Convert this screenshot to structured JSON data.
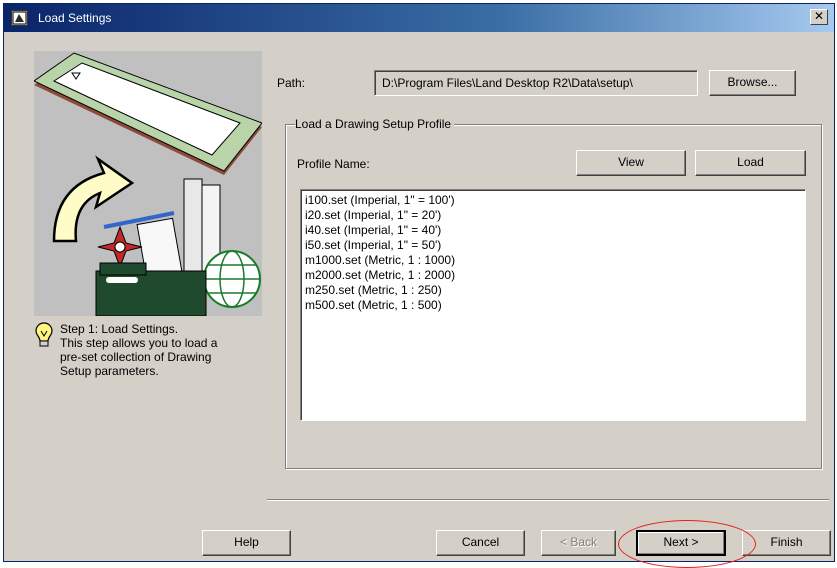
{
  "window": {
    "title": "Load Settings",
    "close_label": "✕"
  },
  "sidebar": {
    "step_lines": [
      "Step 1:  Load Settings.",
      "This step allows you to load a",
      "pre-set collection of Drawing",
      "Setup parameters."
    ]
  },
  "path": {
    "label": "Path:",
    "value": "D:\\Program Files\\Land Desktop R2\\Data\\setup\\",
    "browse_label": "Browse..."
  },
  "profile_group": {
    "title": "Load a Drawing Setup Profile",
    "profile_name_label": "Profile Name:",
    "view_label": "View",
    "load_label": "Load",
    "items": [
      "i100.set  (Imperial, 1\" = 100')",
      "i20.set  (Imperial, 1\" = 20')",
      "i40.set  (Imperial, 1\" = 40')",
      "i50.set  (Imperial, 1\" = 50')",
      "m1000.set  (Metric, 1 : 1000)",
      "m2000.set  (Metric, 1 : 2000)",
      "m250.set  (Metric, 1 : 250)",
      "m500.set  (Metric, 1 : 500)"
    ]
  },
  "footer": {
    "help_label": "Help",
    "cancel_label": "Cancel",
    "back_label": "< Back",
    "next_label": "Next >",
    "finish_label": "Finish"
  },
  "colors": {
    "dialog_bg": "#d4d0c8",
    "title_bar": "#0a246a",
    "highlight_annotation": "#e2231a"
  }
}
